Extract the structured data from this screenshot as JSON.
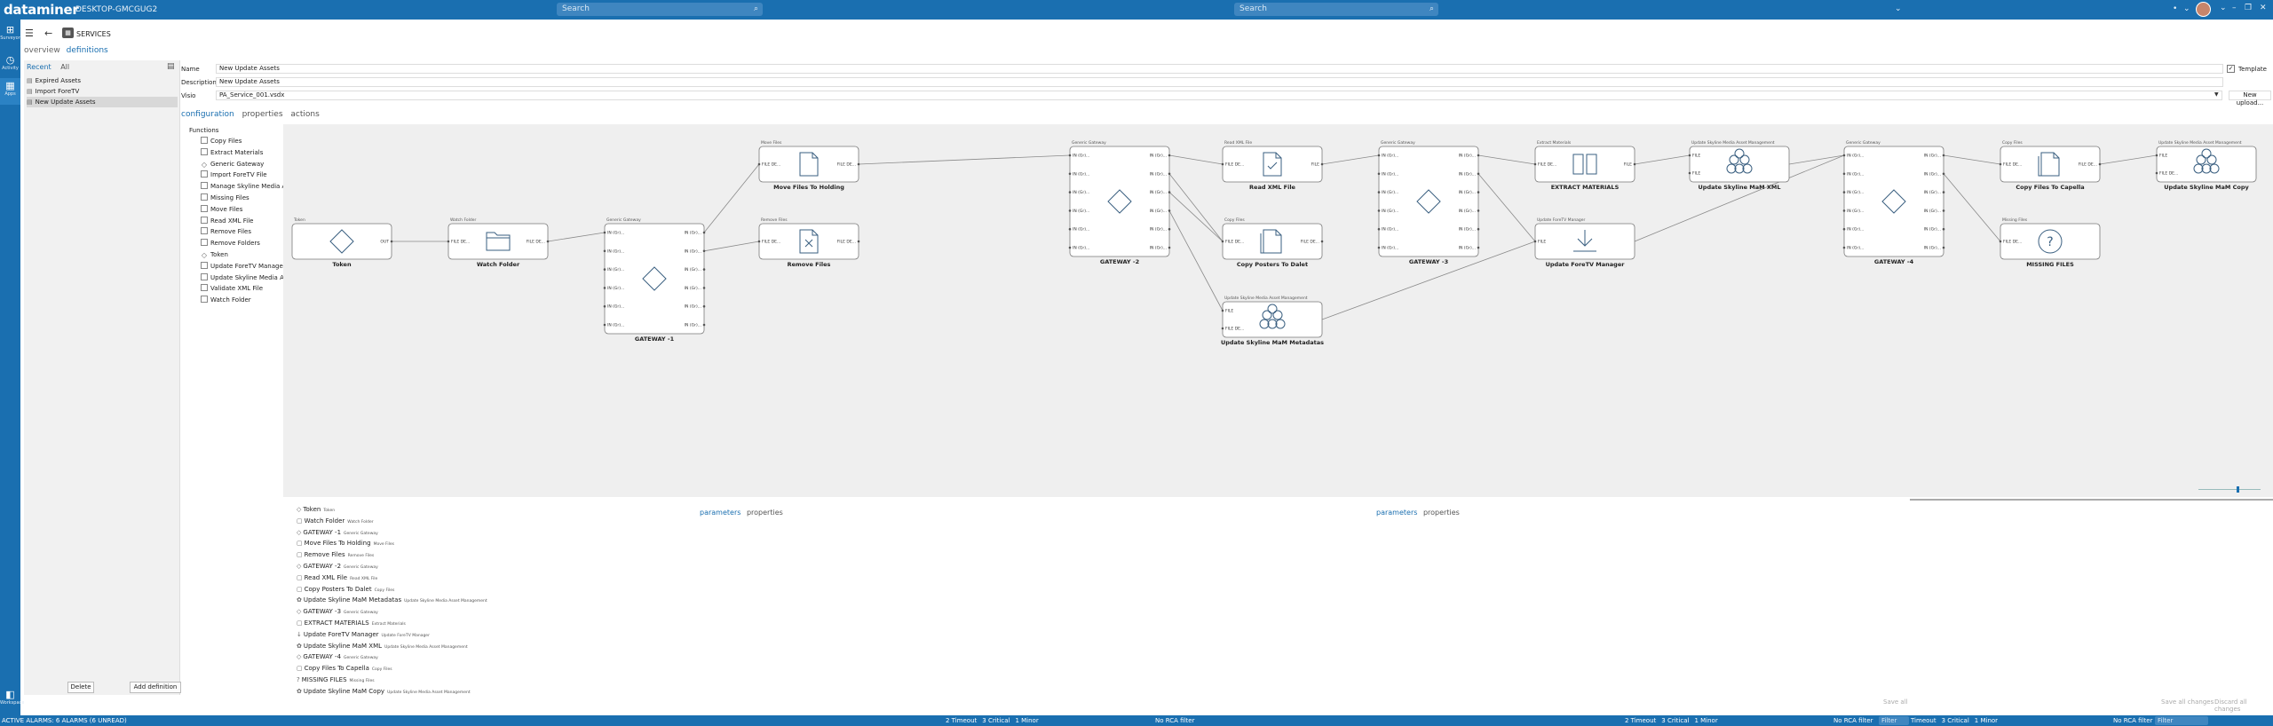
{
  "topbar": {
    "brand": "dataminer",
    "host": "DESKTOP-GMCGUG2",
    "search1_placeholder": "Search",
    "search2_placeholder": "Search",
    "colors": {
      "bar": "#1a6fb0",
      "search": "#3f86c0"
    }
  },
  "rail": {
    "items": [
      {
        "icon": "⊞",
        "label": "Surveyor"
      },
      {
        "icon": "◷",
        "label": "Activity"
      },
      {
        "icon": "▦",
        "label": "Apps"
      }
    ],
    "bottom": {
      "icon": "◧",
      "label": "Workspace"
    }
  },
  "header": {
    "service_title": "SERVICES",
    "subtabs": [
      "overview",
      "definitions"
    ]
  },
  "leftpanel": {
    "tabs": [
      "Recent",
      "All"
    ],
    "items": [
      {
        "icon": "▤",
        "label": "Expired Assets"
      },
      {
        "icon": "▤",
        "label": "Import ForeTV"
      },
      {
        "icon": "▤",
        "label": "New Update Assets"
      }
    ],
    "delete_label": "Delete",
    "add_label": "Add definition"
  },
  "form": {
    "name_label": "Name",
    "name_value": "New Update Assets",
    "desc_label": "Description",
    "desc_value": "New Update Assets",
    "visio_label": "Visio",
    "visio_value": "PA_Service_001.vsdx",
    "template_label": "Template",
    "template_checked": "✓",
    "new_upload_label": "New upload..."
  },
  "cfgtabs": [
    "configuration",
    "properties",
    "actions"
  ],
  "functions": {
    "title": "Functions",
    "items": [
      "Copy Files",
      "Extract Materials",
      "Generic Gateway",
      "Import ForeTV File",
      "Manage Skyline Media Ass",
      "Missing Files",
      "Move Files",
      "Read XML File",
      "Remove Files",
      "Remove Folders",
      "Token",
      "Update ForeTV Manager",
      "Update Skyline Media Ass",
      "Validate XML File",
      "Watch Folder"
    ]
  },
  "nodes": [
    {
      "id": "token",
      "type": "Token",
      "name": "Token",
      "icon": "diamond",
      "in": [],
      "out": [
        "OUT"
      ]
    },
    {
      "id": "watch",
      "type": "Watch Folder",
      "name": "Watch Folder",
      "icon": "folder",
      "in": [
        "FILE DE..."
      ],
      "out": [
        "FILE DE..."
      ]
    },
    {
      "id": "gw1",
      "type": "Generic Gateway",
      "name": "GATEWAY -1",
      "icon": "diamond",
      "in": [
        "IN (Gr)...",
        "IN (Gr)...",
        "IN (Gr)...",
        "IN (Gr)...",
        "IN (Gr)...",
        "IN (Gr)..."
      ],
      "out": [
        "IN (Gr)...",
        "IN (Gr)...",
        "IN (Gr)...",
        "IN (Gr)...",
        "IN (Gr)...",
        "IN (Gr)..."
      ]
    },
    {
      "id": "move",
      "type": "Move Files",
      "name": "Move Files To Holding",
      "icon": "file",
      "in": [
        "FILE DE..."
      ],
      "out": [
        "FILE DE..."
      ]
    },
    {
      "id": "remove",
      "type": "Remove Files",
      "name": "Remove Files",
      "icon": "file-x",
      "in": [
        "FILE DE..."
      ],
      "out": [
        "FILE DE..."
      ]
    },
    {
      "id": "gw2",
      "type": "Generic Gateway",
      "name": "GATEWAY -2",
      "icon": "diamond",
      "in": [
        "IN (Gr)...",
        "IN (Gr)...",
        "IN (Gr)...",
        "IN (Gr)...",
        "IN (Gr)...",
        "IN (Gr)..."
      ],
      "out": [
        "IN (Gr)...",
        "IN (Gr)...",
        "IN (Gr)...",
        "IN (Gr)...",
        "IN (Gr)...",
        "IN (Gr)..."
      ]
    },
    {
      "id": "readxml",
      "type": "Read XML File",
      "name": "Read XML File",
      "icon": "file-check",
      "in": [
        "FILE DE..."
      ],
      "out": [
        "FILE"
      ]
    },
    {
      "id": "copyposters",
      "type": "Copy Files",
      "name": "Copy Posters To Dalet",
      "icon": "files",
      "in": [
        "FILE DE..."
      ],
      "out": [
        "FILE DE..."
      ]
    },
    {
      "id": "updmam",
      "type": "Update Skyline Media Asset Management",
      "name": "Update Skyline MaM Metadatas",
      "icon": "skyline",
      "in": [
        "FILE",
        "FILE DE..."
      ],
      "out": []
    },
    {
      "id": "gw3",
      "type": "Generic Gateway",
      "name": "GATEWAY -3",
      "icon": "diamond",
      "in": [
        "IN (Gr)...",
        "IN (Gr)...",
        "IN (Gr)...",
        "IN (Gr)...",
        "IN (Gr)...",
        "IN (Gr)..."
      ],
      "out": [
        "IN (Gr)...",
        "IN (Gr)...",
        "IN (Gr)...",
        "IN (Gr)...",
        "IN (Gr)...",
        "IN (Gr)..."
      ]
    },
    {
      "id": "extract",
      "type": "Extract Materials",
      "name": "EXTRACT MATERIALS",
      "icon": "book",
      "in": [
        "FILE DE..."
      ],
      "out": [
        "FILE"
      ]
    },
    {
      "id": "updforetv",
      "type": "Update ForeTV Manager",
      "name": "Update ForeTV Manager",
      "icon": "download",
      "in": [
        "FILE"
      ],
      "out": []
    },
    {
      "id": "updmamxml",
      "type": "Update Skyline Media Asset Management",
      "name": "Update Skyline MaM XML",
      "icon": "skyline",
      "in": [
        "FILE",
        "FILE"
      ],
      "out": []
    },
    {
      "id": "gw4",
      "type": "Generic Gateway",
      "name": "GATEWAY -4",
      "icon": "diamond",
      "in": [
        "IN (Gr)...",
        "IN (Gr)...",
        "IN (Gr)...",
        "IN (Gr)...",
        "IN (Gr)...",
        "IN (Gr)..."
      ],
      "out": [
        "IN (Gr)...",
        "IN (Gr)...",
        "IN (Gr)...",
        "IN (Gr)...",
        "IN (Gr)...",
        "IN (Gr)..."
      ]
    },
    {
      "id": "copycap",
      "type": "Copy Files",
      "name": "Copy Files To Capella",
      "icon": "files",
      "in": [
        "FILE DE..."
      ],
      "out": [
        "FILE DE..."
      ]
    },
    {
      "id": "missing",
      "type": "Missing Files",
      "name": "MISSING FILES",
      "icon": "question",
      "in": [
        "FILE DE..."
      ],
      "out": []
    },
    {
      "id": "updmamcopy",
      "type": "Update Skyline Media Asset Management",
      "name": "Update Skyline MaM Copy",
      "icon": "skyline",
      "in": [
        "FILE",
        "FILE DE..."
      ],
      "out": []
    }
  ],
  "ptabs": [
    "parameters",
    "properties"
  ],
  "bottomlist": [
    {
      "icon": "◇",
      "name": "Token",
      "type": "Token"
    },
    {
      "icon": "▢",
      "name": "Watch Folder",
      "type": "Watch Folder"
    },
    {
      "icon": "◇",
      "name": "GATEWAY -1",
      "type": "Generic Gateway"
    },
    {
      "icon": "▢",
      "name": "Move Files To Holding",
      "type": "Move Files"
    },
    {
      "icon": "▢",
      "name": "Remove Files",
      "type": "Remove Files"
    },
    {
      "icon": "◇",
      "name": "GATEWAY -2",
      "type": "Generic Gateway"
    },
    {
      "icon": "▢",
      "name": "Read XML File",
      "type": "Read XML File"
    },
    {
      "icon": "▢",
      "name": "Copy Posters To Dalet",
      "type": "Copy Files"
    },
    {
      "icon": "✿",
      "name": "Update Skyline MaM Metadatas",
      "type": "Update Skyline Media Asset Management"
    },
    {
      "icon": "◇",
      "name": "GATEWAY -3",
      "type": "Generic Gateway"
    },
    {
      "icon": "▢",
      "name": "EXTRACT MATERIALS",
      "type": "Extract Materials"
    },
    {
      "icon": "↓",
      "name": "Update ForeTV Manager",
      "type": "Update ForeTV Manager"
    },
    {
      "icon": "✿",
      "name": "Update Skyline MaM XML",
      "type": "Update Skyline Media Asset Management"
    },
    {
      "icon": "◇",
      "name": "GATEWAY -4",
      "type": "Generic Gateway"
    },
    {
      "icon": "▢",
      "name": "Copy Files To Capella",
      "type": "Copy Files"
    },
    {
      "icon": "?",
      "name": "MISSING FILES",
      "type": "Missing Files"
    },
    {
      "icon": "✿",
      "name": "Update Skyline MaM Copy",
      "type": "Update Skyline Media Asset Management"
    }
  ],
  "bottombuttons": {
    "save_all": "Save all",
    "save_all_changes": "Save all changes",
    "discard_all": "Discard all changes"
  },
  "status": {
    "left": "ACTIVE ALARMS: 6 ALARMS (6 UNREAD)",
    "group1": [
      "2 Timeout",
      "3 Critical",
      "1 Minor"
    ],
    "group2": [
      "2 Timeout",
      "3 Critical",
      "1 Minor"
    ],
    "group3": [
      "Timeout",
      "3 Critical",
      "1 Minor"
    ],
    "no_rca": "No RCA filter",
    "filter_label": "Filter"
  }
}
